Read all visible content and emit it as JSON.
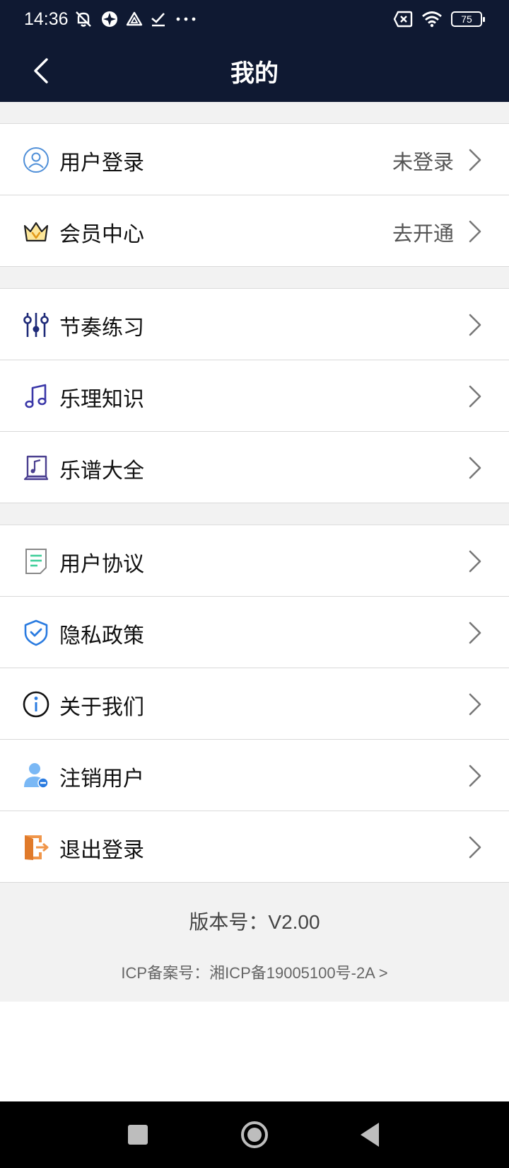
{
  "status_bar": {
    "time": "14:36",
    "battery_level": "75",
    "icons": [
      "mute-icon",
      "app-icon",
      "drive-icon",
      "check-icon",
      "more-dots-icon",
      "sim-off-icon",
      "wifi-icon",
      "battery-icon"
    ]
  },
  "header": {
    "title": "我的"
  },
  "sections": [
    [
      {
        "label": "用户登录",
        "value": "未登录",
        "icon": "user-avatar-icon"
      },
      {
        "label": "会员中心",
        "value": "去开通",
        "icon": "crown-icon"
      }
    ],
    [
      {
        "label": "节奏练习",
        "icon": "sliders-icon"
      },
      {
        "label": "乐理知识",
        "icon": "music-note-icon"
      },
      {
        "label": "乐谱大全",
        "icon": "music-book-icon"
      }
    ],
    [
      {
        "label": "用户协议",
        "icon": "document-icon"
      },
      {
        "label": "隐私政策",
        "icon": "shield-check-icon"
      },
      {
        "label": "关于我们",
        "icon": "info-icon"
      },
      {
        "label": "注销用户",
        "icon": "user-remove-icon"
      },
      {
        "label": "退出登录",
        "icon": "logout-door-icon"
      }
    ]
  ],
  "footer": {
    "version": "版本号：V2.00",
    "icp": "ICP备案号：湘ICP备19005100号-2A >"
  },
  "colors": {
    "header_bg": "#0f1932",
    "section_gap": "#f2f2f2",
    "accent_blue": "#2a7be0",
    "accent_orange": "#f0964a"
  }
}
